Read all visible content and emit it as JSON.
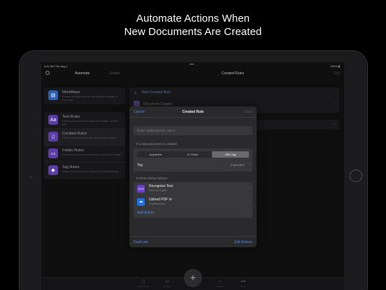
{
  "headline": {
    "line1": "Automate Actions When",
    "line2": "New Documents Are Created"
  },
  "status_bar": {
    "time": "9:41 AM   Tue Aug 1",
    "battery": "100% ▮"
  },
  "nav": {
    "automate": "Automate",
    "export": "Export",
    "title": "Created Rules",
    "edit": "Edit"
  },
  "sidebar": {
    "workflows": {
      "title": "Workflows",
      "subtitle": "Create workflows that you can activate manually or from rules"
    },
    "items": [
      {
        "title": "Text Rules",
        "subtitle": "Perform actions when a document contains specific text",
        "icon": "Aa",
        "color": "#5b3ea8"
      },
      {
        "title": "Created Rules",
        "subtitle": "Perform actions when a new document is created",
        "icon": "📄",
        "color": "#5b3ea8"
      },
      {
        "title": "Folder Rules",
        "subtitle": "Perform actions when a document is added to a folder",
        "icon": "📁",
        "color": "#5b3ea8"
      },
      {
        "title": "Tag Rules",
        "subtitle": "Perform actions when a document is assigned a tag",
        "icon": "🏷",
        "color": "#5b3ea8"
      }
    ]
  },
  "main": {
    "new_rule": "New Created Rule",
    "first_rule": "Document Created"
  },
  "modal": {
    "cancel": "Cancel",
    "title": "Created Rule",
    "save": "Save",
    "name_placeholder": "Enter optional rule name",
    "condition_label": "If a new document is created:",
    "segments": [
      "Anywhere",
      "In Folder",
      "With Tag"
    ],
    "selected_segment": "With Tag",
    "tag_label": "Tag",
    "tag_value": "Important",
    "actions_label": "Perform these actions:",
    "actions": [
      {
        "title": "Recognize Text",
        "subtitle": "First Two Pages",
        "icon": "OCR",
        "color": "#6b3fc7"
      },
      {
        "title": "Upload PDF to",
        "subtitle": "Dropbox/scans",
        "icon": "☁",
        "color": "#1f6fe0"
      }
    ],
    "add_action": "Add Action",
    "duplicate": "Duplicate",
    "edit_actions": "Edit Actions"
  },
  "tabbar": {
    "tabs": [
      {
        "label": "Documents",
        "icon": "doc-icon"
      },
      {
        "label": "Navigate",
        "icon": "binoculars-icon"
      },
      {
        "label": "Scan",
        "icon": "plus-icon"
      },
      {
        "label": "Connect",
        "icon": "connect-icon"
      },
      {
        "label": "More",
        "icon": "ellipsis-icon"
      }
    ]
  }
}
